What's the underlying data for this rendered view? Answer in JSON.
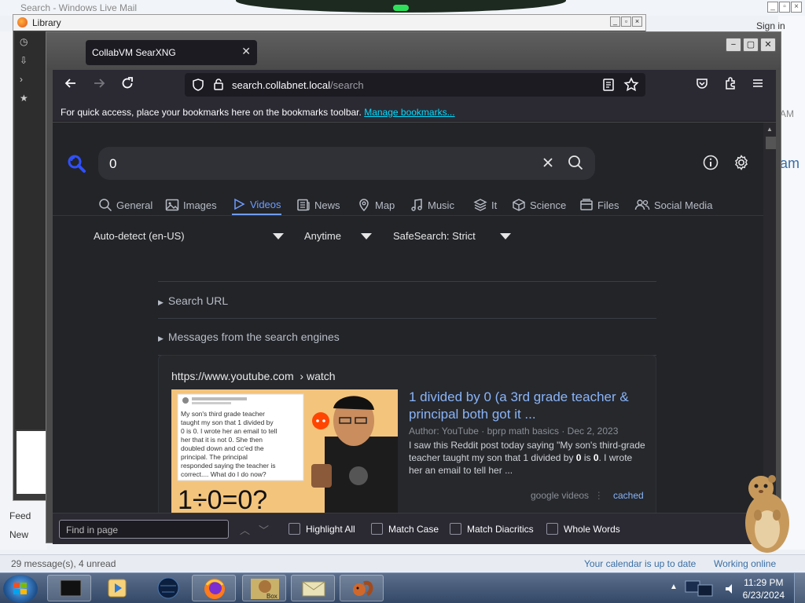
{
  "bg_mail": {
    "title": "Search - Windows Live Mail",
    "signin": "Sign in",
    "right_clip_1": "AM",
    "right_clip_2": "am",
    "left_item_1": "Feed",
    "left_item_2": "New",
    "status_left": "29 message(s), 4 unread",
    "status_calendar": "Your calendar is up to date",
    "status_online": "Working online"
  },
  "library_window": {
    "title": "Library"
  },
  "firefox": {
    "tab_title": "CollabVM SearXNG",
    "url_host": "search.collabnet.local",
    "url_path": "/search",
    "bookmarks_hint": "For quick access, place your bookmarks here on the bookmarks toolbar.",
    "manage_bookmarks": "Manage bookmarks..."
  },
  "search": {
    "query": "0",
    "categories": [
      {
        "label": "General",
        "icon": "search-icon"
      },
      {
        "label": "Images",
        "icon": "image-icon"
      },
      {
        "label": "Videos",
        "icon": "play-icon",
        "active": true
      },
      {
        "label": "News",
        "icon": "newspaper-icon"
      },
      {
        "label": "Map",
        "icon": "map-pin-icon"
      },
      {
        "label": "Music",
        "icon": "music-icon"
      },
      {
        "label": "It",
        "icon": "layers-icon"
      },
      {
        "label": "Science",
        "icon": "cube-icon"
      },
      {
        "label": "Files",
        "icon": "files-icon"
      },
      {
        "label": "Social Media",
        "icon": "people-icon"
      }
    ],
    "language": "Auto-detect (en-US)",
    "time_range": "Anytime",
    "safesearch": "SafeSearch: Strict",
    "details_search_url": "Search URL",
    "details_messages": "Messages from the search engines"
  },
  "result": {
    "url": "https://www.youtube.com",
    "url_path": "› watch",
    "title": "1 divided by 0 (a 3rd grade teacher & principal both got it ...",
    "meta": "Author: YouTube · bprp math basics · Dec 2, 2023",
    "snippet_before": "I saw this Reddit post today saying \"My son's third-grade teacher taught my son that 1 divided by ",
    "snippet_b1": "0",
    "snippet_mid": " is ",
    "snippet_b2": "0",
    "snippet_after": ". I wrote her an email to tell her ...",
    "engines": "google videos",
    "cached": "cached",
    "thumb_text": "My son's third grade teacher taught my son that 1 divided by 0 is 0. I wrote her an email to tell her that it is not 0. She then doubled down and cc'ed the principal. The principal responded saying the teacher is correct.... What do I do now?",
    "thumb_formula": "1÷0=0?"
  },
  "findbar": {
    "placeholder": "Find in page",
    "highlight_all": "Highlight All",
    "match_case": "Match Case",
    "match_diacritics": "Match Diacritics",
    "whole_words": "Whole Words"
  },
  "taskbar": {
    "time": "11:29 PM",
    "date": "6/23/2024",
    "box_label": "Box"
  },
  "colors": {
    "accent_link": "#8ab4f8",
    "category_active": "#6f9cff",
    "page_bg": "#222428",
    "bookmark_link": "#00ddff"
  }
}
